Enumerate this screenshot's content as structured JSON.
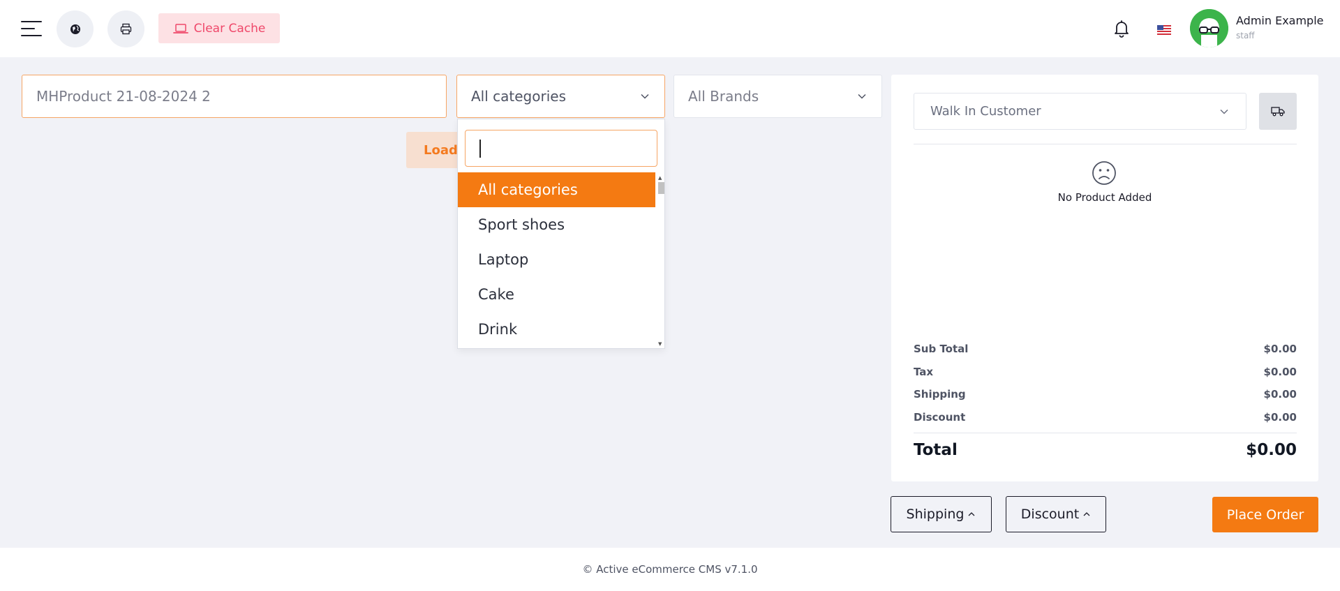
{
  "header": {
    "menu_icon": "hamburger-menu-icon",
    "globe_icon": "globe-icon",
    "print_icon": "printer-icon",
    "clear_cache_label": "Clear Cache",
    "clear_cache_icon": "laptop-icon",
    "notification_icon": "bell-icon",
    "language_flag_icon": "us-flag-icon",
    "user": {
      "name": "Admin Example",
      "role": "staff",
      "avatar_icon": "avatar-glasses-icon"
    }
  },
  "filters": {
    "search_value": "MHProduct 21-08-2024 2",
    "category_selected": "All categories",
    "brand_selected": "All Brands"
  },
  "loading_label": "Loading",
  "category_dropdown": {
    "search_value": "",
    "items": [
      "All categories",
      "Sport shoes",
      "Laptop",
      "Cake",
      "Drink"
    ],
    "selected_index": 0
  },
  "cart": {
    "customer_selected": "Walk In Customer",
    "shipping_icon": "truck-icon",
    "empty_icon": "sad-face-icon",
    "empty_message": "No Product Added",
    "summary": [
      {
        "label": "Sub Total",
        "value": "$0.00"
      },
      {
        "label": "Tax",
        "value": "$0.00"
      },
      {
        "label": "Shipping",
        "value": "$0.00"
      },
      {
        "label": "Discount",
        "value": "$0.00"
      }
    ],
    "total_label": "Total",
    "total_value": "$0.00"
  },
  "actions": {
    "shipping_label": "Shipping",
    "discount_label": "Discount",
    "place_order_label": "Place Order"
  },
  "footer": {
    "text": "© Active eCommerce CMS v7.1.0"
  },
  "colors": {
    "accent": "#f47a12",
    "clear_cache_bg": "#fde1e4",
    "clear_cache_text": "#ef486a",
    "avatar_bg": "#3cb44b"
  }
}
